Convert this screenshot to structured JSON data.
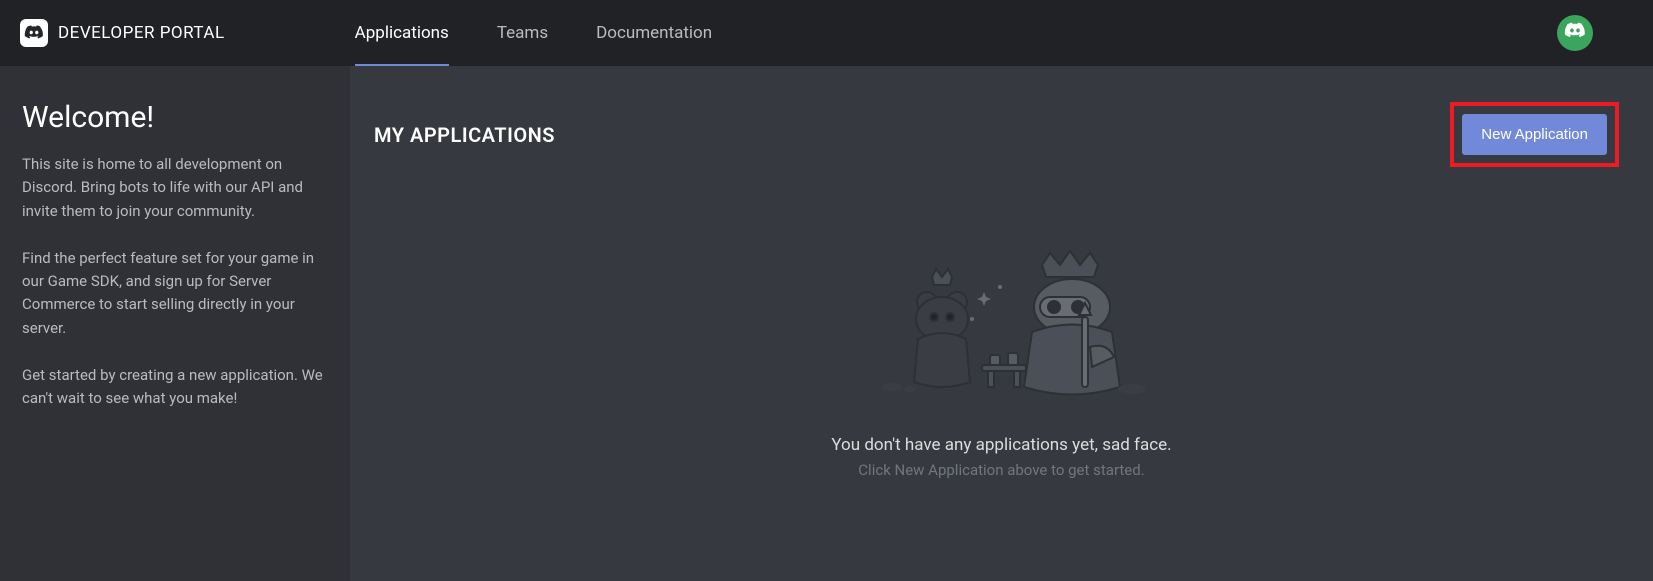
{
  "header": {
    "brand": "DEVELOPER PORTAL",
    "nav": {
      "applications": "Applications",
      "teams": "Teams",
      "documentation": "Documentation"
    }
  },
  "sidebar": {
    "title": "Welcome!",
    "p1": "This site is home to all development on Discord. Bring bots to life with our API and invite them to join your community.",
    "p2": "Find the perfect feature set for your game in our Game SDK, and sign up for Server Commerce to start selling directly in your server.",
    "p3": "Get started by creating a new application. We can't wait to see what you make!"
  },
  "main": {
    "title": "MY APPLICATIONS",
    "new_app_label": "New Application",
    "empty_primary": "You don't have any applications yet, sad face.",
    "empty_secondary": "Click New Application above to get started."
  },
  "colors": {
    "accent": "#7289da",
    "highlight_border": "#ed1c24",
    "avatar_bg": "#3ba55d"
  }
}
